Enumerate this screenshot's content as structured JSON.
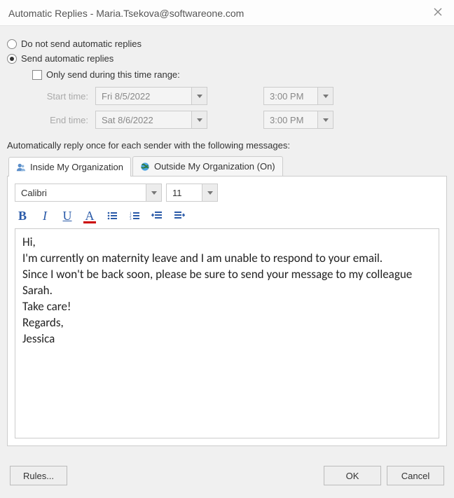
{
  "titlebar": {
    "text": "Automatic Replies - Maria.Tsekova@softwareone.com"
  },
  "options": {
    "do_not_send": "Do not send automatic replies",
    "send": "Send automatic replies",
    "only_range": "Only send during this time range:",
    "start_label": "Start time:",
    "end_label": "End time:",
    "start_date": "Fri 8/5/2022",
    "start_time": "3:00 PM",
    "end_date": "Sat 8/6/2022",
    "end_time": "3:00 PM"
  },
  "section_label": "Automatically reply once for each sender with the following messages:",
  "tabs": {
    "inside": "Inside My Organization",
    "outside": "Outside My Organization (On)"
  },
  "editor": {
    "font_name": "Calibri",
    "font_size": "11",
    "message": "Hi,\nI'm currently on maternity leave and I am unable to respond to your email.\nSince I won't be back soon, please be sure to send your message to my colleague Sarah.\nTake care!\nRegards,\nJessica"
  },
  "footer": {
    "rules": "Rules...",
    "ok": "OK",
    "cancel": "Cancel"
  }
}
